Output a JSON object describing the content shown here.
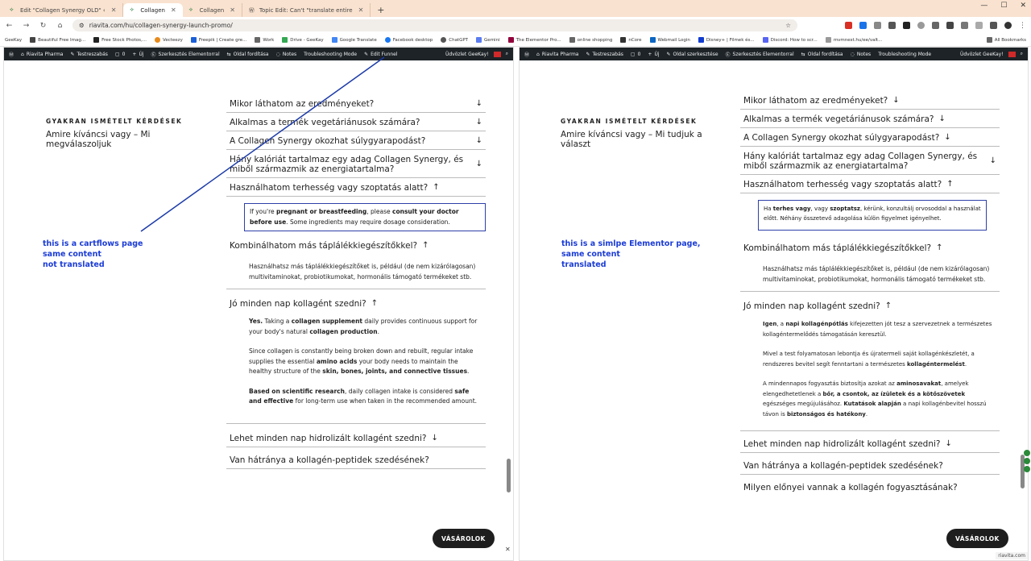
{
  "browser": {
    "tabs": [
      {
        "label": "Edit \"Collagen Synergy OLD\" ‹"
      },
      {
        "label": "Collagen"
      },
      {
        "label": "Collagen"
      },
      {
        "label": "Topic Edit: Can't \"translate entire"
      }
    ],
    "url": "riavita.com/hu/collagen-synergy-launch-promo/",
    "bookmarks": [
      "GeeKay",
      "Beautiful Free Imag...",
      "Free Stock Photos,...",
      "Vecteezy",
      "Freepik | Create gre...",
      "Work",
      "Drive - GeeKay",
      "Google Translate",
      "Facebook desktop",
      "ChatGPT",
      "Gemini",
      "The Elementor Pro...",
      "online shopping",
      "nCore",
      "Webmail Login",
      "Disney+ | Filmek és...",
      "Discord: How to scr...",
      "mvmnest.hu/ee/valt...",
      "All Bookmarks"
    ]
  },
  "left": {
    "wpbar": {
      "site": "Riavita Pharma",
      "customize": "Testreszabás",
      "comments": "0",
      "new": "Új",
      "elementor": "Szerkesztés Elementorral",
      "translate": "Oldal fordítása",
      "notes": "Notes",
      "troubleshoot": "Troubleshooting Mode",
      "funnel": "Edit Funnel",
      "greeting": "Üdvözlet GeeKay!"
    },
    "eyebrow": "GYAKRAN ISMÉTELT KÉRDÉSEK",
    "subtitle": "Amire kíváncsi vagy – Mi megválaszoljuk",
    "note": [
      "this is a cartflows page",
      "same content",
      "not translated"
    ],
    "q1": "Mikor láthatom az eredményeket?",
    "q2": "Alkalmas a termék vegetáriánusok számára?",
    "q3": "A Collagen Synergy okozhat súlygyarapodást?",
    "q4": "Hány kalóriát tartalmaz egy adag Collagen Synergy, és miből származmik az energiatartalma?",
    "q5": "Használhatom terhesség vagy szoptatás alatt?",
    "a5": {
      "t1": "If you're ",
      "b1": "pregnant or breastfeeding",
      "t2": ", please ",
      "b2": "consult your doctor before use",
      "t3": ". Some ingredients may require dosage consideration."
    },
    "q6": "Kombinálhatom más táplálékkiegészítőkkel?",
    "a6": "Használhatsz más táplálékkiegészítőket is, például (de nem kizárólagosan) multivitaminokat, probiotikumokat, hormonális támogató termékeket stb.",
    "q7": "Jó minden nap kollagént szedni?",
    "a7": {
      "p1": {
        "b1": "Yes.",
        "t1": " Taking a ",
        "b2": "collagen supplement",
        "t2": " daily provides continuous support for your body's natural ",
        "b3": "collagen production",
        "t3": "."
      },
      "p2": {
        "t1": "Since collagen is constantly being broken down and rebuilt, regular intake supplies the essential ",
        "b1": "amino acids",
        "t2": " your body needs to maintain the healthy structure of the ",
        "b2": "skin, bones, joints, and connective tissues",
        "t3": "."
      },
      "p3": {
        "b1": "Based on scientific research",
        "t1": ", daily collagen intake is considered ",
        "b2": "safe and effective",
        "t2": " for long-term use when taken in the recommended amount."
      }
    },
    "q8": "Lehet minden nap hidrolizált kollagént szedni?",
    "q9": "Van hátránya a kollagén-peptidek szedésének?",
    "buy": "VÁSÁROLOK"
  },
  "right": {
    "wpbar": {
      "site": "Riavita Pharma",
      "customize": "Testreszabás",
      "comments": "0",
      "new": "Új",
      "edit": "Oldal szerkesztése",
      "elementor": "Szerkesztés Elementorral",
      "translate": "Oldal fordítása",
      "notes": "Notes",
      "troubleshoot": "Troubleshooting Mode",
      "greeting": "Üdvözlet GeeKay!"
    },
    "eyebrow": "GYAKRAN ISMÉTELT KÉRDÉSEK",
    "subtitle": "Amire kíváncsi vagy – Mi tudjuk a választ",
    "note": [
      "this is a simlpe Elementor page,",
      "same content",
      "translated"
    ],
    "q1": "Mikor láthatom az eredményeket?",
    "q2": "Alkalmas a termék vegetáriánusok számára?",
    "q3": "A Collagen Synergy okozhat súlygyarapodást?",
    "q4": "Hány kalóriát tartalmaz egy adag Collagen Synergy, és miből származmik az energiatartalma?",
    "q5": "Használhatom terhesség vagy szoptatás alatt?",
    "a5": {
      "t1": "Ha ",
      "b1": "terhes vagy",
      "t2": ", vagy ",
      "b2": "szoptatsz",
      "t3": ", kérünk, konzultálj orvosoddal a használat előtt. Néhány összetevő adagolása külön figyelmet igényelhet."
    },
    "q6": "Kombinálhatom más táplálékkiegészítőkkel?",
    "a6": "Használhatsz más táplálékkiegészítőket is, például (de nem kizárólagosan) multivitaminokat, probiotikumokat, hormonális támogató termékeket stb.",
    "q7": "Jó minden nap kollagént szedni?",
    "a7": {
      "p1": {
        "b1": "Igen",
        "t1": ", a ",
        "b2": "napi kollagénpótlás",
        "t2": " kifejezetten jót tesz a szervezetnek a természetes kollagéntermelődés támogatásán keresztül."
      },
      "p2": {
        "t1": "Mivel a test folyamatosan lebontja és újratermeli saját kollagénkészletét, a rendszeres bevitel segít fenntartani a természetes ",
        "b1": "kollagéntermelést",
        "t2": "."
      },
      "p3": {
        "t1": "A mindennapos fogyasztás biztosítja azokat az ",
        "b1": "aminosavakat",
        "t2": ", amelyek elengedhetetlenek a ",
        "b2": "bőr, a csontok, az ízületek és a kötőszövetek",
        "t3": " egészséges megújulásához. ",
        "b3": "Kutatások alapján",
        "t4": " a napi kollagénbevitel hosszú távon is ",
        "b4": "biztonságos és hatékony",
        "t5": "."
      }
    },
    "q8": "Lehet minden nap hidrolizált kollagént szedni?",
    "q9": "Van hátránya a kollagén-peptidek szedésének?",
    "q10": "Milyen előnyei vannak a kollagén fogyasztásának?",
    "buy": "VÁSÁROLOK"
  },
  "corner_link": "riavita.com"
}
